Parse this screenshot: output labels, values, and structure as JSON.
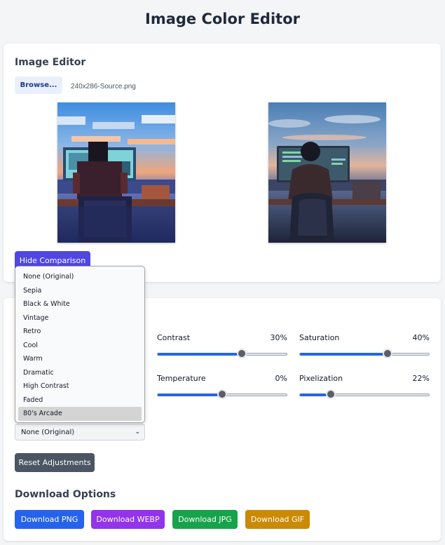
{
  "page_title": "Image Color Editor",
  "editor": {
    "section_title": "Image Editor",
    "browse_label": "Browse...",
    "file_name": "240x286-Source.png",
    "hide_comparison_label": "Hide Comparison"
  },
  "adjustments": {
    "sliders": [
      {
        "label": "Contrast",
        "value_text": "30%",
        "level": 0.65
      },
      {
        "label": "Saturation",
        "value_text": "40%",
        "level": 0.68
      },
      {
        "label": "Temperature",
        "value_text": "0%",
        "level": 0.5
      },
      {
        "label": "Pixelization",
        "value_text": "22%",
        "level": 0.24
      }
    ],
    "preset_select": {
      "selected": "None (Original)",
      "options": [
        "None (Original)",
        "Sepia",
        "Black & White",
        "Vintage",
        "Retro",
        "Cool",
        "Warm",
        "Dramatic",
        "High Contrast",
        "Faded",
        "80's Arcade"
      ],
      "highlighted": "80's Arcade"
    },
    "reset_label": "Reset Adjustments"
  },
  "download": {
    "section_title": "Download Options",
    "buttons": [
      {
        "label": "Download PNG",
        "color": "#2563eb"
      },
      {
        "label": "Download WEBP",
        "color": "#9333ea"
      },
      {
        "label": "Download JPG",
        "color": "#16a34a"
      },
      {
        "label": "Download GIF",
        "color": "#ca8a04"
      }
    ]
  }
}
